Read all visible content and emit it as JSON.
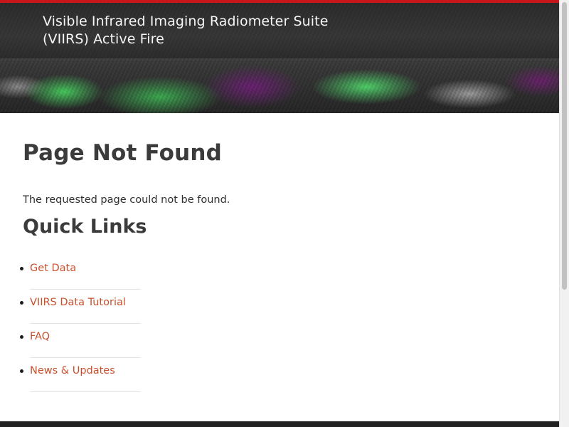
{
  "header": {
    "title": "Visible Infrared Imaging Radiometer Suite (VIIRS) Active Fire"
  },
  "page": {
    "title": "Page Not Found",
    "message": "The requested page could not be found."
  },
  "quick_links": {
    "title": "Quick Links",
    "items": [
      {
        "label": "Get Data"
      },
      {
        "label": "VIIRS Data Tutorial"
      },
      {
        "label": "FAQ"
      },
      {
        "label": "News & Updates"
      }
    ]
  },
  "colors": {
    "accent": "#c8161d",
    "link": "#c9502d",
    "heading": "#3b3b3b"
  }
}
